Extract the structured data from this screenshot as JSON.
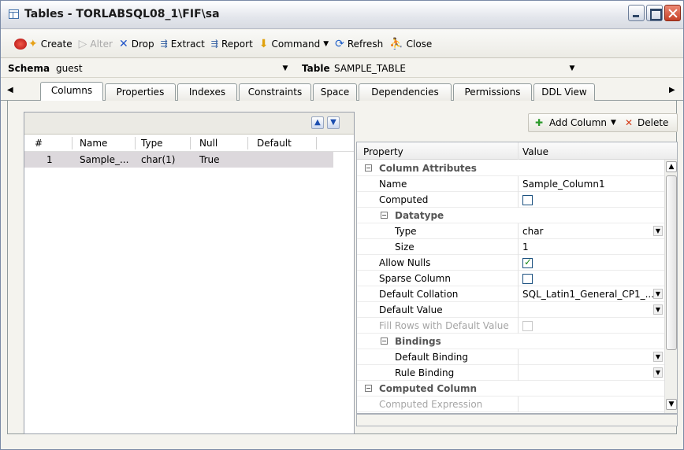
{
  "window": {
    "title": "Tables - TORLABSQL08_1\\FIF\\sa"
  },
  "toolbar": {
    "create": "Create",
    "alter": "Alter",
    "drop": "Drop",
    "extract": "Extract",
    "report": "Report",
    "command": "Command",
    "refresh": "Refresh",
    "close": "Close"
  },
  "selectors": {
    "schema_label": "Schema",
    "schema_value": "guest",
    "table_label": "Table",
    "table_value": "SAMPLE_TABLE"
  },
  "tabs": [
    {
      "label": "Columns",
      "active": true
    },
    {
      "label": "Properties"
    },
    {
      "label": "Indexes"
    },
    {
      "label": "Constraints"
    },
    {
      "label": "Space"
    },
    {
      "label": "Dependencies"
    },
    {
      "label": "Permissions"
    },
    {
      "label": "DDL View"
    }
  ],
  "columns_grid": {
    "headers": [
      "#",
      "Name",
      "Type",
      "Null",
      "Default"
    ],
    "rows": [
      {
        "num": "1",
        "name": "Sample_...",
        "type": "char(1)",
        "null": "True",
        "default": ""
      }
    ]
  },
  "actions": {
    "add_column": "Add Column",
    "delete": "Delete"
  },
  "property_grid": {
    "headers": {
      "property": "Property",
      "value": "Value"
    },
    "rows": [
      {
        "kind": "group",
        "label": "Column Attributes",
        "indent": 0
      },
      {
        "kind": "text",
        "label": "Name",
        "value": "Sample_Column1",
        "indent": 1
      },
      {
        "kind": "check",
        "label": "Computed",
        "checked": false,
        "indent": 1
      },
      {
        "kind": "group",
        "label": "Datatype",
        "indent": 1
      },
      {
        "kind": "dropdown",
        "label": "Type",
        "value": "char",
        "indent": 2
      },
      {
        "kind": "text",
        "label": "Size",
        "value": "1",
        "indent": 2
      },
      {
        "kind": "check",
        "label": "Allow Nulls",
        "checked": true,
        "indent": 1
      },
      {
        "kind": "check",
        "label": "Sparse Column",
        "checked": false,
        "indent": 1
      },
      {
        "kind": "dropdown",
        "label": "Default Collation",
        "value": "SQL_Latin1_General_CP1_...",
        "indent": 1
      },
      {
        "kind": "dropdown",
        "label": "Default Value",
        "value": "",
        "indent": 1
      },
      {
        "kind": "check",
        "label": "Fill Rows with Default Value",
        "checked": false,
        "disabled": true,
        "indent": 1
      },
      {
        "kind": "group",
        "label": "Bindings",
        "indent": 1
      },
      {
        "kind": "dropdown",
        "label": "Default Binding",
        "value": "",
        "indent": 2
      },
      {
        "kind": "dropdown",
        "label": "Rule Binding",
        "value": "",
        "indent": 2
      },
      {
        "kind": "group",
        "label": "Computed Column",
        "indent": 0
      },
      {
        "kind": "text",
        "label": "Computed Expression",
        "value": "",
        "disabled": true,
        "indent": 1
      }
    ]
  }
}
